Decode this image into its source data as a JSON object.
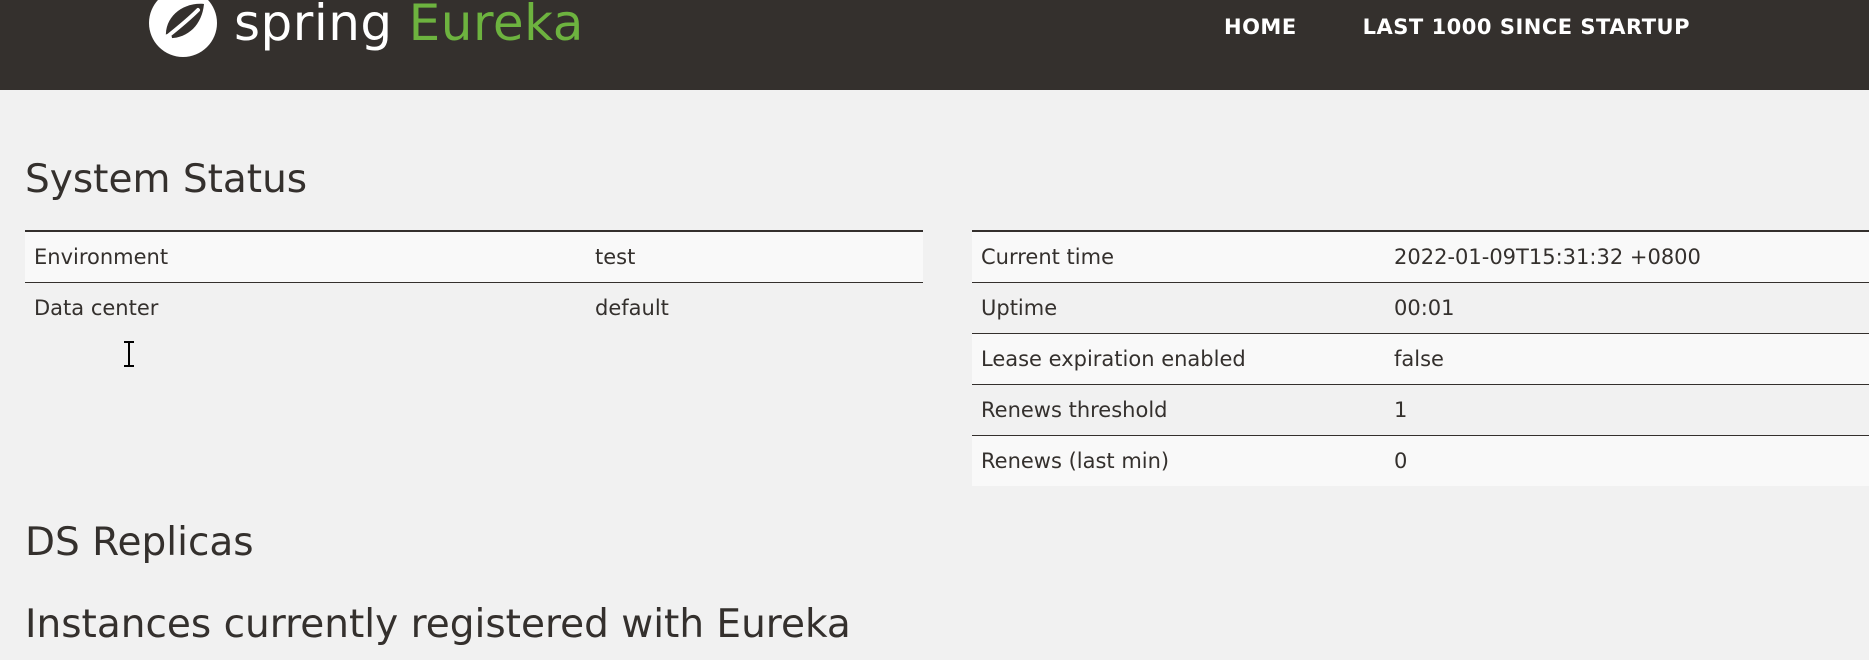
{
  "header": {
    "brand": {
      "word1": "spring",
      "word2": "Eureka",
      "logo_icon": "spring-leaf-icon"
    },
    "nav": [
      {
        "label": "HOME"
      },
      {
        "label": "LAST 1000 SINCE STARTUP"
      }
    ]
  },
  "sections": {
    "system_status": "System Status",
    "ds_replicas": "DS Replicas",
    "instances": "Instances currently registered with Eureka"
  },
  "system_left": [
    {
      "key": "Environment",
      "value": "test"
    },
    {
      "key": "Data center",
      "value": "default"
    }
  ],
  "system_right": [
    {
      "key": "Current time",
      "value": "2022-01-09T15:31:32 +0800"
    },
    {
      "key": "Uptime",
      "value": "00:01"
    },
    {
      "key": "Lease expiration enabled",
      "value": "false"
    },
    {
      "key": "Renews threshold",
      "value": "1"
    },
    {
      "key": "Renews (last min)",
      "value": "0"
    }
  ],
  "colors": {
    "navbar": "#34302d",
    "brand_green": "#6db33f",
    "page_bg": "#f1f1f1",
    "text": "#34302d"
  }
}
